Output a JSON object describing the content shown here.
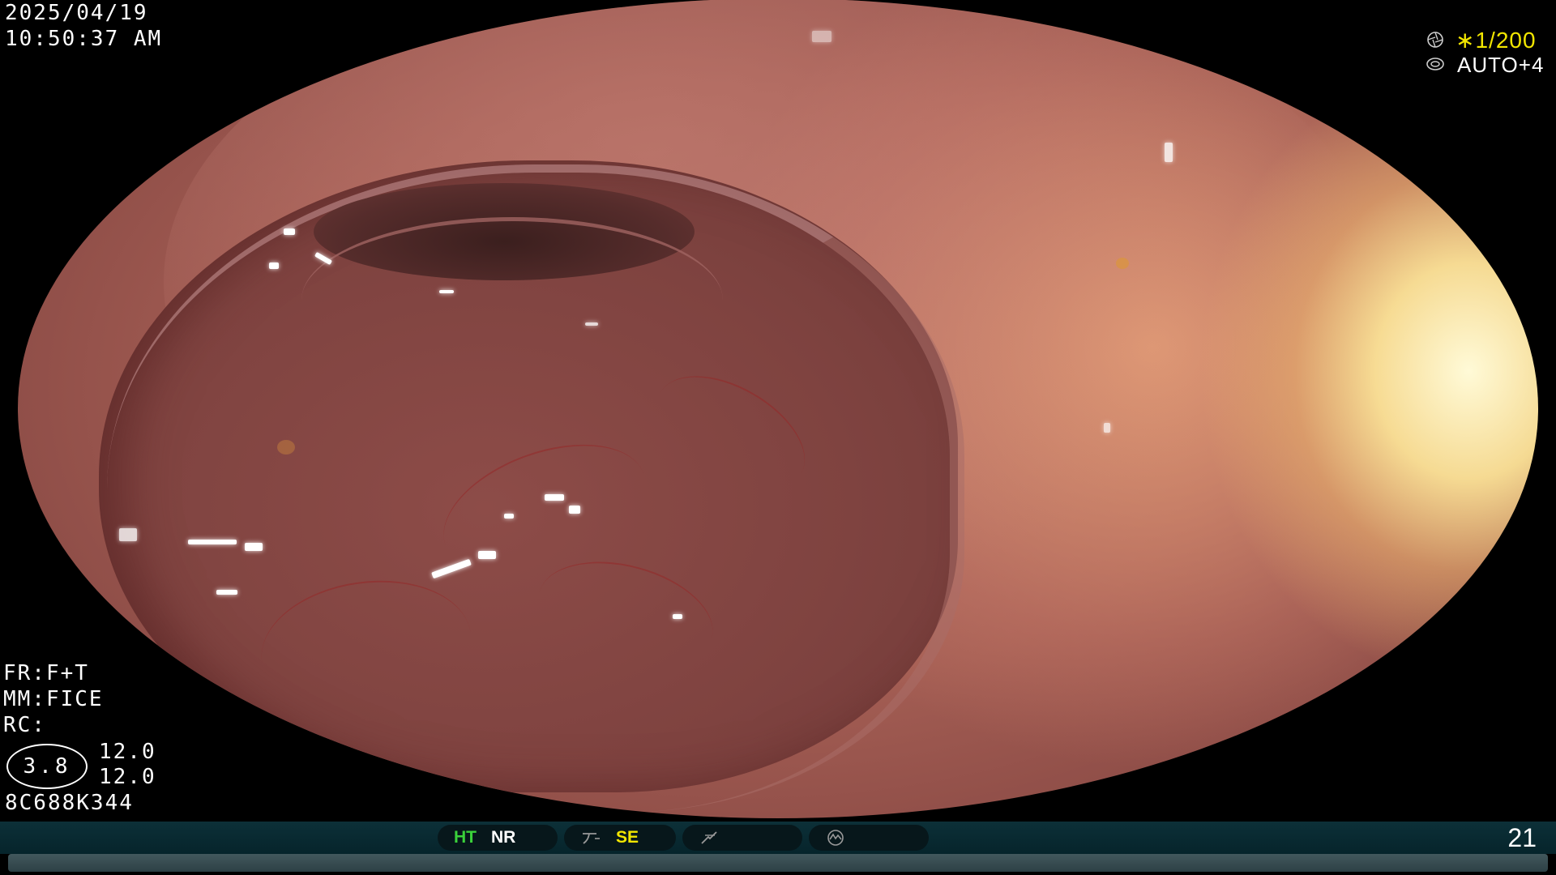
{
  "overlay": {
    "date": "2025/04/19",
    "time": "10:50:37   AM",
    "shutter": "∗1/200",
    "exposure": "AUTO+4",
    "fr": "FR:F+T",
    "mm": "MM:FICE",
    "rc": "RC:",
    "rc_value": "3.8",
    "value_1": "12.0",
    "value_2": "12.0",
    "serial": "8C688K344"
  },
  "status_bar": {
    "ht_label": "HT",
    "nr_label": "NR",
    "se_label": "SE",
    "frame_number": "21",
    "colors": {
      "ht": "#3ad13a",
      "nr": "#ffffff",
      "se": "#f2e600"
    }
  },
  "icons": [
    "shutter-icon",
    "auto-exposure-icon",
    "tone-curve-icon",
    "frequency-icon",
    "mode-icon"
  ]
}
